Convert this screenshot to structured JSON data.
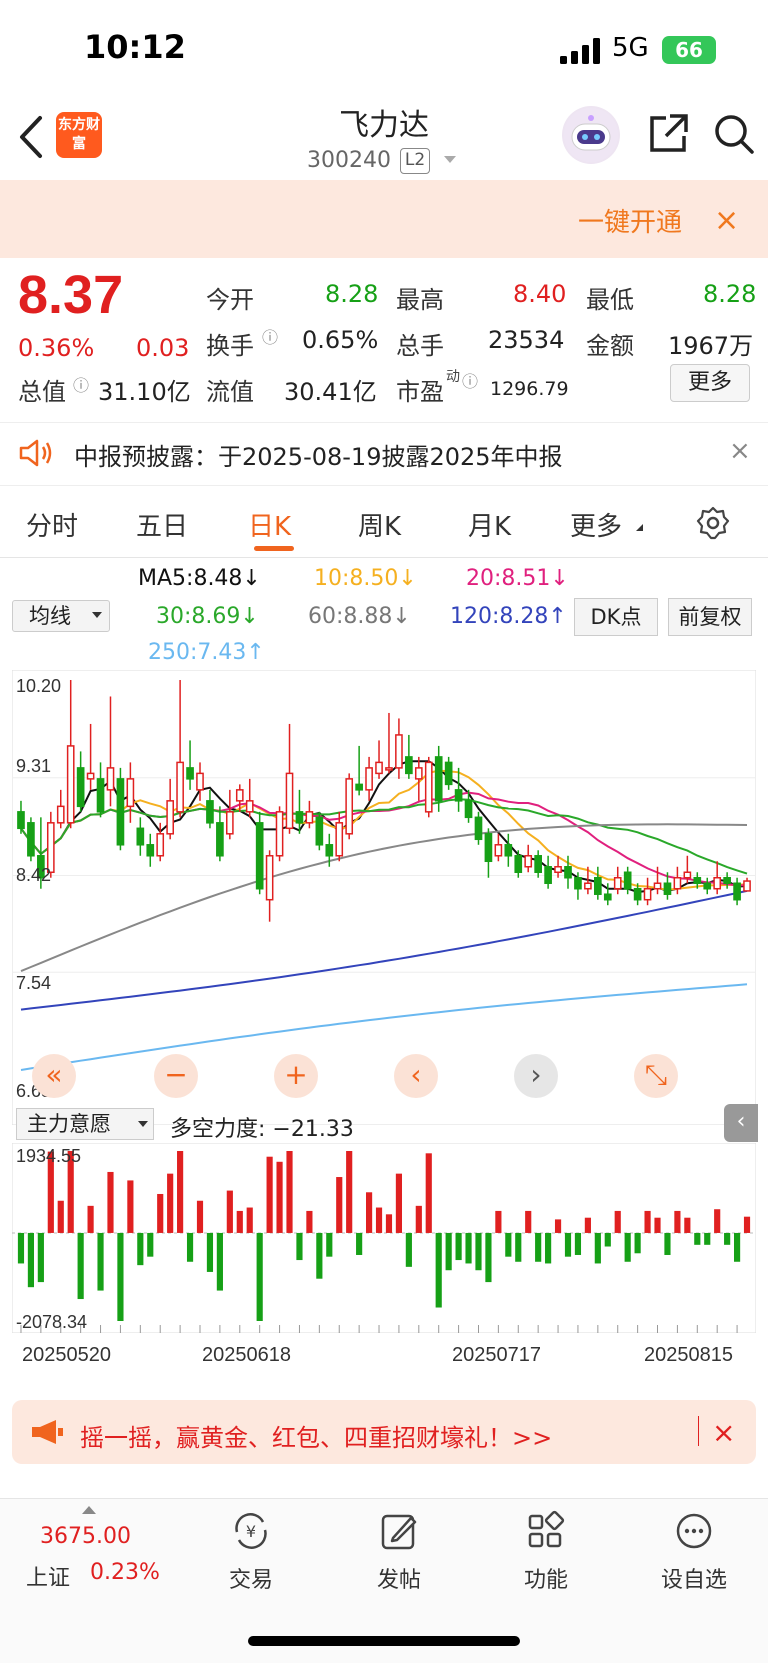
{
  "status_bar": {
    "time": "10:12",
    "network": "5G",
    "battery": "66"
  },
  "header": {
    "logo_text": "东方财富",
    "stock_name": "飞力达",
    "stock_code": "300240",
    "level_badge": "L2"
  },
  "top_banner": {
    "cta": "一键开通",
    "close": "×"
  },
  "quote": {
    "price": "8.37",
    "change_pct": "0.36%",
    "change": "0.03",
    "market_cap_label": "总值",
    "market_cap": "31.10亿",
    "open_label": "今开",
    "open": "8.28",
    "high_label": "最高",
    "high": "8.40",
    "low_label": "最低",
    "low": "8.28",
    "turnover_label": "换手",
    "turnover": "0.65%",
    "volume_label": "总手",
    "volume": "23534",
    "amount_label": "金额",
    "amount": "1967万",
    "float_cap_label": "流值",
    "float_cap": "30.41亿",
    "pe_label": "市盈",
    "pe_sup": "动",
    "pe": "1296.79",
    "more_button": "更多"
  },
  "notice": {
    "text": "中报预披露：于2025-08-19披露2025年中报",
    "close": "×"
  },
  "tabs": [
    "分时",
    "五日",
    "日K",
    "周K",
    "月K",
    "更多"
  ],
  "active_tab": "日K",
  "ma_row": {
    "select": "均线",
    "ma5": "MA5:8.48↓",
    "ma10": "10:8.50↓",
    "ma20": "20:8.51↓",
    "ma30": "30:8.69↓",
    "ma60": "60:8.88↓",
    "ma120": "120:8.28↑",
    "ma250": "250:7.43↑",
    "dk_button": "DK点",
    "fq_button": "前复权"
  },
  "colors": {
    "up": "#e02020",
    "down": "#16a016",
    "ma5": "#111111",
    "ma10": "#f5b020",
    "ma20": "#e0207e",
    "ma30": "#2aa82a",
    "ma60": "#888888",
    "ma120": "#3344bb",
    "ma250": "#6ab8f0"
  },
  "chart_data": {
    "type": "candlestick",
    "y_axis_labels": [
      "10.20",
      "9.31",
      "8.42",
      "7.54",
      "6.65"
    ],
    "ylim": [
      6.65,
      10.2
    ],
    "candles": [
      [
        9.0,
        8.85,
        9.1,
        8.8
      ],
      [
        8.9,
        8.6,
        8.95,
        8.55
      ],
      [
        8.6,
        8.4,
        8.95,
        8.3
      ],
      [
        8.45,
        8.9,
        9.0,
        8.4
      ],
      [
        8.9,
        9.05,
        9.2,
        8.85
      ],
      [
        8.9,
        9.6,
        10.2,
        8.85
      ],
      [
        9.4,
        9.05,
        9.55,
        9.0
      ],
      [
        9.3,
        9.35,
        9.8,
        9.2
      ],
      [
        9.3,
        9.0,
        9.45,
        8.95
      ],
      [
        9.2,
        9.4,
        10.05,
        9.05
      ],
      [
        9.3,
        8.7,
        9.4,
        8.65
      ],
      [
        9.05,
        9.3,
        9.45,
        8.9
      ],
      [
        8.85,
        8.7,
        8.95,
        8.6
      ],
      [
        8.7,
        8.6,
        8.8,
        8.5
      ],
      [
        8.6,
        8.8,
        8.9,
        8.55
      ],
      [
        8.8,
        9.1,
        9.3,
        8.75
      ],
      [
        9.0,
        9.45,
        10.2,
        8.95
      ],
      [
        9.4,
        9.3,
        9.65,
        9.2
      ],
      [
        9.2,
        9.35,
        9.45,
        9.1
      ],
      [
        9.1,
        8.9,
        9.2,
        8.85
      ],
      [
        8.9,
        8.6,
        9.05,
        8.55
      ],
      [
        8.8,
        9.0,
        9.2,
        8.75
      ],
      [
        9.1,
        9.2,
        9.25,
        9.0
      ],
      [
        9.0,
        9.1,
        9.3,
        8.95
      ],
      [
        8.9,
        8.3,
        9.0,
        8.25
      ],
      [
        8.2,
        8.6,
        8.65,
        8.0
      ],
      [
        8.6,
        9.0,
        9.05,
        8.55
      ],
      [
        8.85,
        9.35,
        9.8,
        8.8
      ],
      [
        9.0,
        8.9,
        9.2,
        8.8
      ],
      [
        8.9,
        9.0,
        9.1,
        8.85
      ],
      [
        8.95,
        8.7,
        9.0,
        8.65
      ],
      [
        8.7,
        8.6,
        8.8,
        8.5
      ],
      [
        8.6,
        8.9,
        9.0,
        8.55
      ],
      [
        8.8,
        9.3,
        9.35,
        8.75
      ],
      [
        9.25,
        9.2,
        9.6,
        9.15
      ],
      [
        9.2,
        9.4,
        9.5,
        9.1
      ],
      [
        9.35,
        9.45,
        9.65,
        9.3
      ],
      [
        9.4,
        9.4,
        9.9,
        9.35
      ],
      [
        9.4,
        9.7,
        9.85,
        9.3
      ],
      [
        9.5,
        9.35,
        9.7,
        9.3
      ],
      [
        9.3,
        9.4,
        9.5,
        9.1
      ],
      [
        9.0,
        9.45,
        9.5,
        8.95
      ],
      [
        9.5,
        9.1,
        9.6,
        9.0
      ],
      [
        9.45,
        9.25,
        9.5,
        9.2
      ],
      [
        9.2,
        9.1,
        9.4,
        9.0
      ],
      [
        9.1,
        8.95,
        9.2,
        8.9
      ],
      [
        8.95,
        8.75,
        9.0,
        8.7
      ],
      [
        8.8,
        8.55,
        8.85,
        8.4
      ],
      [
        8.6,
        8.7,
        8.8,
        8.55
      ],
      [
        8.7,
        8.6,
        8.8,
        8.5
      ],
      [
        8.6,
        8.45,
        8.65,
        8.4
      ],
      [
        8.5,
        8.6,
        8.7,
        8.45
      ],
      [
        8.6,
        8.45,
        8.65,
        8.4
      ],
      [
        8.5,
        8.35,
        8.6,
        8.3
      ],
      [
        8.45,
        8.5,
        8.6,
        8.4
      ],
      [
        8.5,
        8.4,
        8.6,
        8.3
      ],
      [
        8.4,
        8.3,
        8.45,
        8.2
      ],
      [
        8.3,
        8.35,
        8.5,
        8.25
      ],
      [
        8.4,
        8.25,
        8.5,
        8.2
      ],
      [
        8.25,
        8.2,
        8.35,
        8.15
      ],
      [
        8.3,
        8.4,
        8.5,
        8.25
      ],
      [
        8.45,
        8.3,
        8.5,
        8.25
      ],
      [
        8.3,
        8.2,
        8.35,
        8.15
      ],
      [
        8.2,
        8.3,
        8.4,
        8.15
      ],
      [
        8.3,
        8.35,
        8.5,
        8.25
      ],
      [
        8.35,
        8.25,
        8.45,
        8.2
      ],
      [
        8.3,
        8.4,
        8.5,
        8.25
      ],
      [
        8.4,
        8.45,
        8.6,
        8.35
      ],
      [
        8.4,
        8.35,
        8.45,
        8.3
      ],
      [
        8.35,
        8.3,
        8.4,
        8.25
      ],
      [
        8.3,
        8.4,
        8.55,
        8.25
      ],
      [
        8.4,
        8.35,
        8.45,
        8.3
      ],
      [
        8.35,
        8.2,
        8.4,
        8.15
      ],
      [
        8.28,
        8.37,
        8.4,
        8.28
      ]
    ],
    "sub_chart": {
      "title": "主力意愿",
      "indicator_label": "多空力度: −21.33",
      "ylim": [
        -2078.34,
        1934.55
      ],
      "y_axis_labels": [
        "1934.55",
        "-2078.34"
      ],
      "dates": [
        "20250520",
        "20250618",
        "20250717",
        "20250815"
      ]
    }
  },
  "chart_controls": [
    "«",
    "−",
    "+",
    "‹",
    "›",
    "⤡"
  ],
  "bottom_promo": {
    "text": "摇一摇，赢黄金、红包、四重招财壕礼！>>",
    "close": "×"
  },
  "bottom_nav": {
    "index_value": "3675.00",
    "index_name": "上证",
    "index_pct": "0.23%",
    "items": [
      {
        "label": "交易",
        "icon": "yuan-transfer-icon"
      },
      {
        "label": "发帖",
        "icon": "edit-post-icon"
      },
      {
        "label": "功能",
        "icon": "grid-apps-icon"
      },
      {
        "label": "设自选",
        "icon": "more-dots-icon"
      }
    ]
  }
}
